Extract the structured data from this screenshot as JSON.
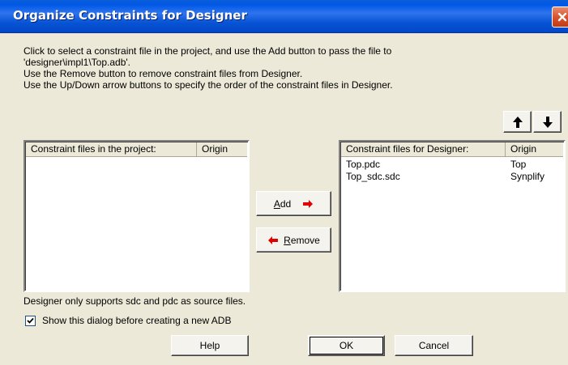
{
  "window": {
    "title": "Organize Constraints for Designer"
  },
  "instructions": [
    "Click to select a constraint file in the project, and use the Add button to pass the file to",
    "'designer\\impl1\\Top.adb'.",
    "Use the Remove button to remove constraint files from Designer.",
    "Use the Up/Down arrow buttons to specify the order of the constraint files in Designer."
  ],
  "left_list": {
    "headers": [
      "Constraint files in the project:",
      "Origin"
    ],
    "rows": []
  },
  "right_list": {
    "headers": [
      "Constraint files for Designer:",
      "Origin"
    ],
    "rows": [
      {
        "file": "Top.pdc",
        "origin": "Top"
      },
      {
        "file": "Top_sdc.sdc",
        "origin": "Synplify"
      }
    ]
  },
  "buttons": {
    "add": {
      "mnemonic": "A",
      "rest": "dd"
    },
    "remove": {
      "mnemonic": "R",
      "rest": "emove"
    },
    "help": "Help",
    "ok": "OK",
    "cancel": "Cancel"
  },
  "note": "Designer only supports sdc and pdc as source files.",
  "checkbox": {
    "label": "Show this dialog before creating a new ADB",
    "checked": true
  },
  "colors": {
    "titlebar": "#0054e3",
    "accent_arrow": "#e00000",
    "dialog_bg": "#ece9d8"
  },
  "icons": {
    "up": "arrow-up-icon",
    "down": "arrow-down-icon",
    "close": "close-icon"
  }
}
